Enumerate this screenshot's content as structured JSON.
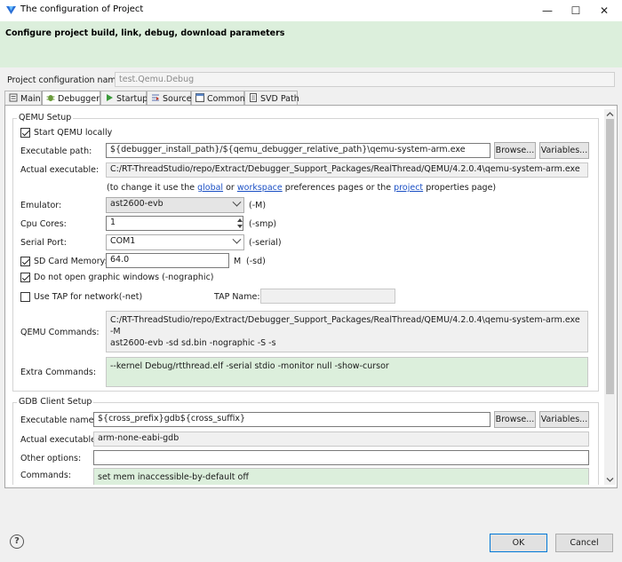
{
  "window": {
    "title": "The configuration of Project",
    "minimize": "—",
    "maximize": "☐",
    "close": "✕"
  },
  "banner": {
    "title": "Configure project build, link, debug, download parameters"
  },
  "config": {
    "label": "Project configuration name:",
    "value": "test.Qemu.Debug"
  },
  "tabs": [
    {
      "label": "Main",
      "icon": "main-tab-icon"
    },
    {
      "label": "Debugger",
      "icon": "debugger-tab-icon"
    },
    {
      "label": "Startup",
      "icon": "startup-tab-icon"
    },
    {
      "label": "Source",
      "icon": "source-tab-icon"
    },
    {
      "label": "Common",
      "icon": "common-tab-icon"
    },
    {
      "label": "SVD Path",
      "icon": "svd-tab-icon"
    }
  ],
  "qemu": {
    "group_title": "QEMU Setup",
    "start_local": {
      "label": "Start QEMU locally",
      "checked": true
    },
    "exec_path_label": "Executable path:",
    "exec_path": "${debugger_install_path}/${qemu_debugger_relative_path}\\qemu-system-arm.exe",
    "browse": "Browse...",
    "variables": "Variables...",
    "actual_label": "Actual executable:",
    "actual_value": "C:/RT-ThreadStudio/repo/Extract/Debugger_Support_Packages/RealThread/QEMU/4.2.0.4\\qemu-system-arm.exe",
    "hint_prefix": "(to change it use the",
    "hint_global": "global",
    "hint_or": "or",
    "hint_workspace": "workspace",
    "hint_middle": "preferences pages or the",
    "hint_project": "project",
    "hint_suffix": "properties page)",
    "emulator_label": "Emulator:",
    "emulator_value": "ast2600-evb",
    "emulator_flag": "(-M)",
    "cores_label": "Cpu Cores:",
    "cores_value": "1",
    "cores_flag": "(-smp)",
    "serial_label": "Serial Port:",
    "serial_value": "COM1",
    "serial_flag": "(-serial)",
    "sd": {
      "label": "SD Card Memory:",
      "checked": true
    },
    "sd_value": "64.0",
    "sd_unit": "M",
    "sd_flag": "(-sd)",
    "nographic": {
      "label": "Do not open graphic windows (-nographic)",
      "checked": true
    },
    "tap": {
      "label": "Use TAP for network(-net)",
      "checked": false
    },
    "tap_name_label": "TAP Name:",
    "tap_name_value": "",
    "commands_label": "QEMU Commands:",
    "commands_value": "C:/RT-ThreadStudio/repo/Extract/Debugger_Support_Packages/RealThread/QEMU/4.2.0.4\\qemu-system-arm.exe -M\nast2600-evb -sd sd.bin -nographic -S -s",
    "extra_label": "Extra Commands:",
    "extra_value": "--kernel Debug/rtthread.elf -serial stdio -monitor null -show-cursor"
  },
  "gdb": {
    "group_title": "GDB Client Setup",
    "exec_name_label": "Executable name:",
    "exec_name_value": "${cross_prefix}gdb${cross_suffix}",
    "browse": "Browse...",
    "variables": "Variables...",
    "actual_label": "Actual executable:",
    "actual_value": "arm-none-eabi-gdb",
    "other_label": "Other options:",
    "other_value": "",
    "commands_label": "Commands:",
    "commands_value": "set mem inaccessible-by-default off"
  },
  "footer": {
    "help": "?",
    "ok": "OK",
    "cancel": "Cancel"
  },
  "colors": {
    "banner": "#dcefdc",
    "extra_commands_bg": "#dcefdc",
    "link": "#1a4fc4",
    "ok_border": "#0078d7"
  }
}
